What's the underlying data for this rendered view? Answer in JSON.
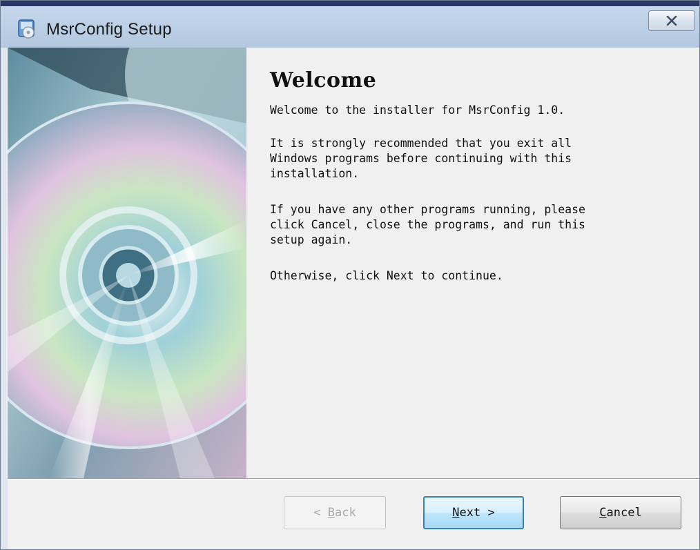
{
  "window": {
    "title": "MsrConfig Setup",
    "accent": "#3c7fb1"
  },
  "icons": {
    "app": "installer-app-icon",
    "close": "close-icon"
  },
  "main": {
    "heading": "Welcome",
    "paragraph1": "Welcome to the installer for MsrConfig 1.0.",
    "paragraph2": "It is strongly recommended that you exit all\nWindows programs before continuing with this\ninstallation.",
    "paragraph3": "If you have any other programs running, please\nclick Cancel, close the programs, and run this\nsetup again.",
    "paragraph4": "Otherwise, click Next to continue."
  },
  "buttons": {
    "back": {
      "prefix": "< ",
      "mnemonic": "B",
      "rest": "ack",
      "enabled": false
    },
    "next": {
      "mnemonic": "N",
      "rest": "ext",
      "suffix": " >",
      "enabled": true
    },
    "cancel": {
      "mnemonic": "C",
      "rest": "ancel",
      "enabled": true
    }
  }
}
